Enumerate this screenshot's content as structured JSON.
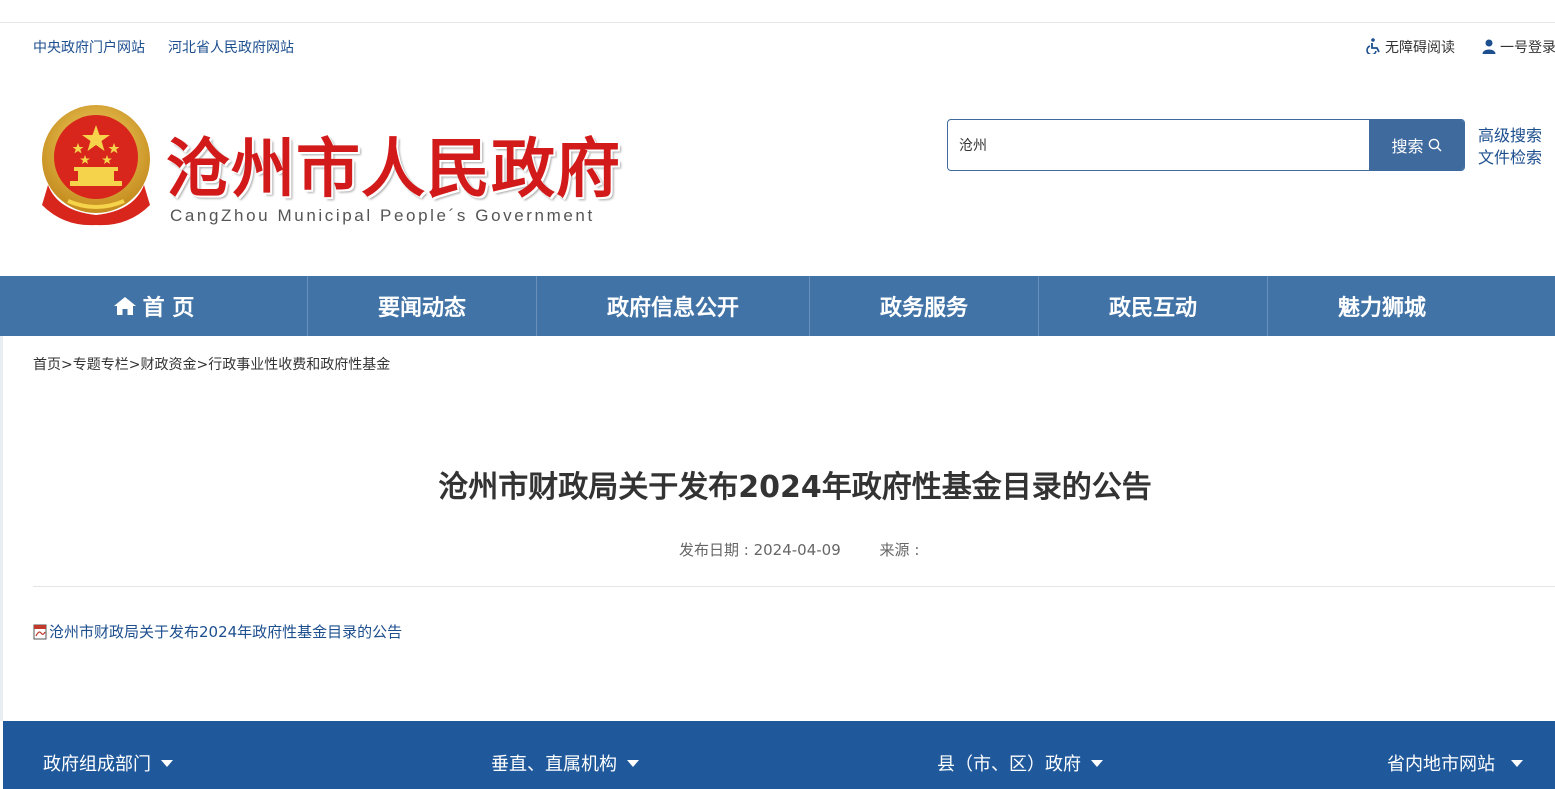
{
  "topbar": {
    "link1": "中央政府门户网站",
    "link2": "河北省人民政府网站",
    "accessibility": "无障碍阅读",
    "login": "一号登录"
  },
  "header": {
    "title": "沧州市人民政府",
    "subtitle": "CangZhou Municipal People´s Government"
  },
  "search": {
    "value": "沧州",
    "button_label": "搜索",
    "advanced": "高级搜索",
    "file_search": "文件检索"
  },
  "nav": {
    "items": [
      {
        "label": "首 页"
      },
      {
        "label": "要闻动态"
      },
      {
        "label": "政府信息公开"
      },
      {
        "label": "政务服务"
      },
      {
        "label": "政民互动"
      },
      {
        "label": "魅力狮城"
      }
    ]
  },
  "breadcrumb": {
    "items": [
      "首页",
      "专题专栏",
      "财政资金",
      "行政事业性收费和政府性基金"
    ],
    "separator": ">"
  },
  "article": {
    "title": "沧州市财政局关于发布2024年政府性基金目录的公告",
    "date_label": "发布日期 : 2024-04-09",
    "source_label": "来源 :",
    "attachment": "沧州市财政局关于发布2024年政府性基金目录的公告"
  },
  "footer": {
    "items": [
      "政府组成部门",
      "垂直、直属机构",
      "县（市、区）政府",
      "省内地市网站"
    ]
  },
  "colors": {
    "nav_bg": "#4173a6",
    "footer_bg": "#20599b",
    "title_red": "#d21a1a",
    "link_blue": "#1d4f8f"
  }
}
